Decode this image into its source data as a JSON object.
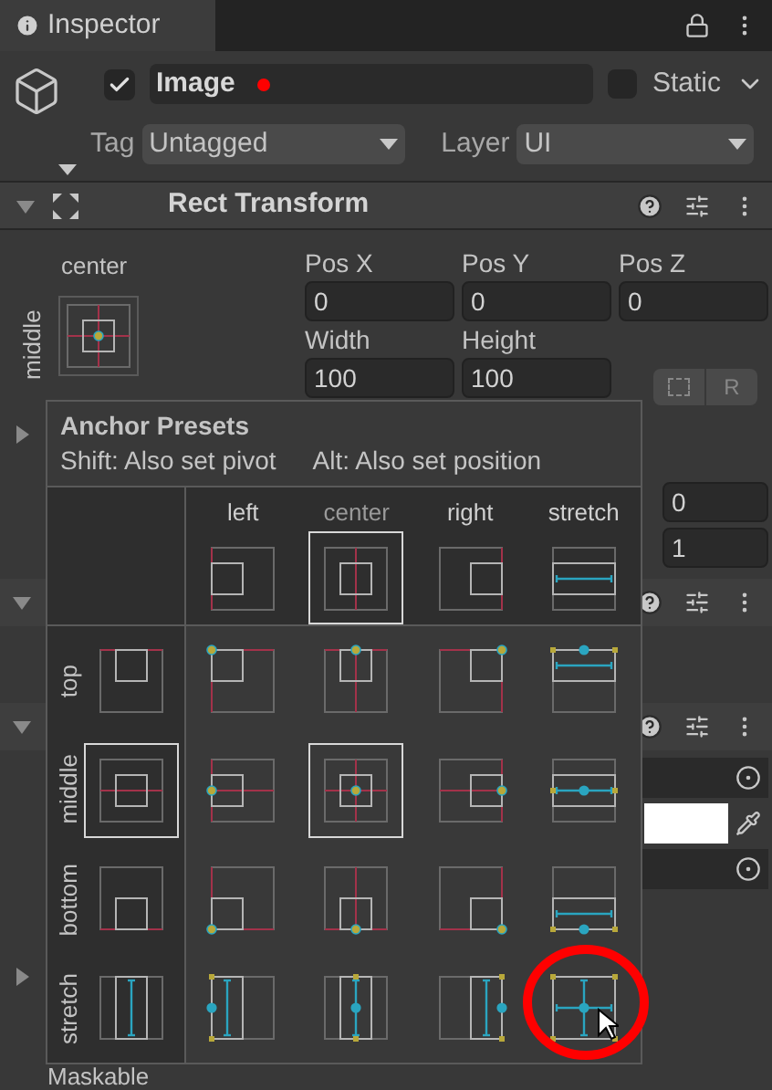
{
  "tab": {
    "title": "Inspector"
  },
  "object": {
    "active": true,
    "name": "Image",
    "modified": true,
    "static": false,
    "static_label": "Static",
    "tag_label": "Tag",
    "tag": "Untagged",
    "layer_label": "Layer",
    "layer": "UI"
  },
  "rect_transform": {
    "title": "Rect Transform",
    "expanded": true,
    "anchor_h": "center",
    "anchor_v": "middle",
    "raw_button": "R",
    "fields": [
      {
        "label": "Pos X",
        "value": "0"
      },
      {
        "label": "Pos Y",
        "value": "0"
      },
      {
        "label": "Pos Z",
        "value": "0"
      },
      {
        "label": "Width",
        "value": "100"
      },
      {
        "label": "Height",
        "value": "100"
      }
    ]
  },
  "side_fields": [
    "0",
    "1"
  ],
  "foldouts": [
    {
      "expanded": false
    },
    {
      "expanded": true
    },
    {
      "expanded": true
    },
    {
      "expanded": false
    }
  ],
  "anchor_presets": {
    "title": "Anchor Presets",
    "hints": [
      "Shift: Also set pivot",
      "Alt: Also set position"
    ],
    "columns": [
      {
        "label": "left",
        "selected": false
      },
      {
        "label": "center",
        "selected": true
      },
      {
        "label": "right",
        "selected": false
      },
      {
        "label": "stretch",
        "selected": false
      }
    ],
    "rows": [
      {
        "label": "top",
        "selected": false,
        "cells": [
          {
            "selected": false,
            "circled": false
          },
          {
            "selected": false,
            "circled": false
          },
          {
            "selected": false,
            "circled": false
          },
          {
            "selected": false,
            "circled": false
          }
        ]
      },
      {
        "label": "middle",
        "selected": true,
        "cells": [
          {
            "selected": false,
            "circled": false
          },
          {
            "selected": true,
            "circled": false
          },
          {
            "selected": false,
            "circled": false
          },
          {
            "selected": false,
            "circled": false
          }
        ]
      },
      {
        "label": "bottom",
        "selected": false,
        "cells": [
          {
            "selected": false,
            "circled": false
          },
          {
            "selected": false,
            "circled": false
          },
          {
            "selected": false,
            "circled": false
          },
          {
            "selected": false,
            "circled": false
          }
        ]
      },
      {
        "label": "stretch",
        "selected": false,
        "cells": [
          {
            "selected": false,
            "circled": false
          },
          {
            "selected": false,
            "circled": false
          },
          {
            "selected": false,
            "circled": false
          },
          {
            "selected": false,
            "circled": true
          }
        ]
      }
    ]
  },
  "last_label": "Maskable"
}
